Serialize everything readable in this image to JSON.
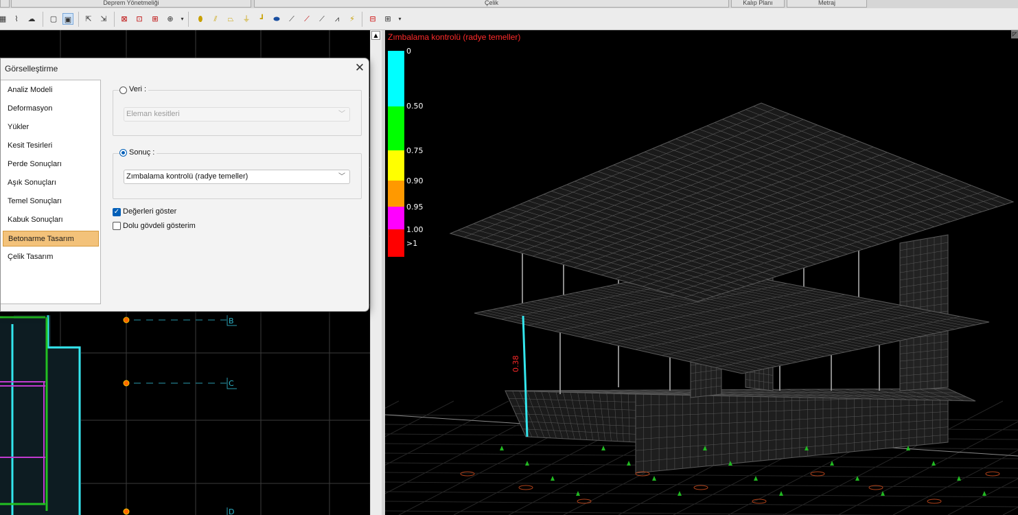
{
  "topbar": {
    "tabs": [
      "Deprem Yönetmeliği",
      "Çelik",
      "Kalıp Planı",
      "Metraj"
    ]
  },
  "toolbar": {
    "icons": [
      "floor-view-icon",
      "section-view-icon",
      "window-single-icon",
      "window-split-icon",
      "refresh-icon",
      "pan-icon",
      "frame-x-icon",
      "frame-z-icon",
      "frame-sr-icon",
      "frame-zoom-icon",
      "column-icon",
      "beam-icon",
      "slab-icon",
      "axis-icon",
      "wall-icon",
      "foundation-icon",
      "dimension-icon",
      "node-icon",
      "support-icon",
      "graph-icon",
      "load-icon",
      "delete-icon",
      "grid-icon"
    ]
  },
  "dialog": {
    "title": "Görselleştirme",
    "close_glyph": "✕",
    "nav": {
      "selected": "Betonarme Tasarım",
      "items": [
        "Analiz Modeli",
        "Deformasyon",
        "Yükler",
        "Kesit Tesirleri",
        "Perde Sonuçları",
        "Aşık Sonuçları",
        "Temel Sonuçları",
        "Kabuk Sonuçları",
        "Betonarme Tasarım",
        "Çelik Tasarım"
      ]
    },
    "veri": {
      "label": "Veri :",
      "selected": false,
      "combo_value": "Eleman kesitleri",
      "enabled": false
    },
    "sonuc": {
      "label": "Sonuç :",
      "selected": true,
      "combo_value": "Zımbalama kontrolü (radye temeller)"
    },
    "options": {
      "show_values": {
        "label": "Değerleri göster",
        "checked": true
      },
      "solid_body": {
        "label": "Dolu gövdeli gösterim",
        "checked": false
      }
    }
  },
  "view3d": {
    "title": "Zımbalama kontrolü (radye temeller)",
    "value_label": "0.38",
    "legend": [
      {
        "label": "0",
        "color": "#00ffff"
      },
      {
        "label": "0.50",
        "color": "#00ff00"
      },
      {
        "label": "0.75",
        "color": "#ffff00"
      },
      {
        "label": "0.90",
        "color": "#ff9900"
      },
      {
        "label": "0.95",
        "color": "#ff00ff"
      },
      {
        "label": "1.00",
        "color": "#ff0000"
      },
      {
        "label": ">1",
        "color": ""
      }
    ]
  },
  "plan": {
    "axes": [
      "B",
      "C",
      "D"
    ]
  },
  "colors": {
    "accent": "#005fb8",
    "selected_nav": "#f3c27a",
    "plan_wall": "#33e6ee",
    "mesh": "#5a5a5a",
    "title_red": "#ff2a2a"
  }
}
